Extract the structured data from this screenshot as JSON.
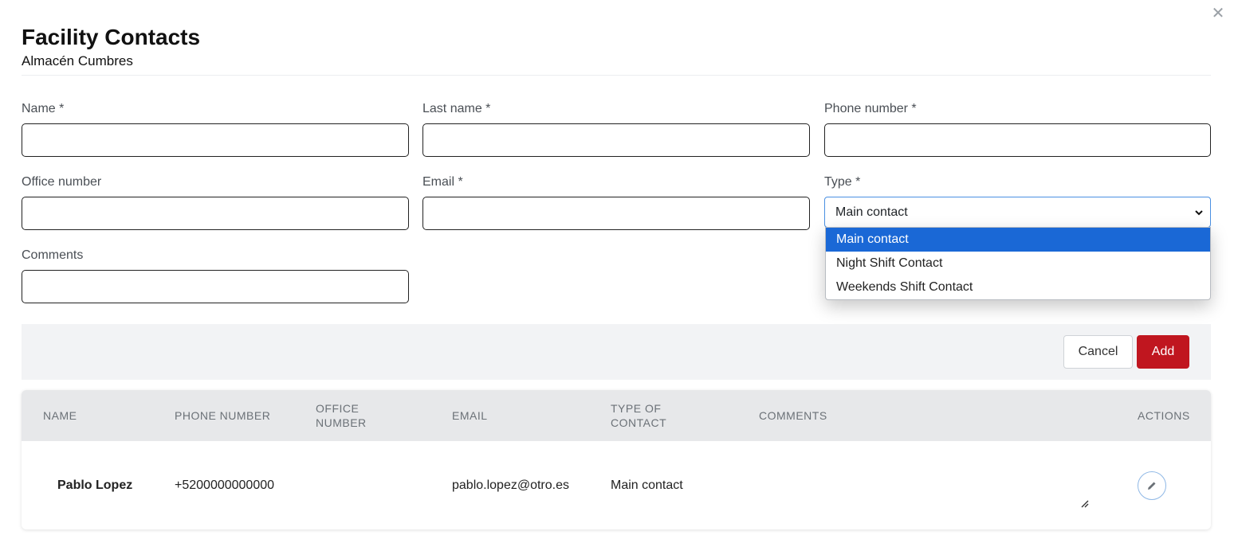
{
  "modal": {
    "title": "Facility Contacts",
    "subtitle": "Almacén Cumbres",
    "close_icon": "close-icon"
  },
  "form": {
    "name_label": "Name *",
    "last_name_label": "Last name *",
    "phone_label": "Phone number *",
    "office_label": "Office number",
    "email_label": "Email *",
    "type_label": "Type *",
    "comments_label": "Comments",
    "name_value": "",
    "last_name_value": "",
    "phone_value": "",
    "office_value": "",
    "email_value": "",
    "comments_value": "",
    "type_selected": "Main contact",
    "type_options": [
      "Main contact",
      "Night Shift Contact",
      "Weekends Shift Contact"
    ]
  },
  "actions": {
    "cancel_label": "Cancel",
    "add_label": "Add"
  },
  "table": {
    "headers": {
      "name": "NAME",
      "phone": "PHONE NUMBER",
      "office": "OFFICE NUMBER",
      "email": "EMAIL",
      "type": "TYPE OF CONTACT",
      "comments": "COMMENTS",
      "actions": "ACTIONS"
    },
    "rows": [
      {
        "name": "Pablo Lopez",
        "phone": "+5200000000000",
        "office": "",
        "email": "pablo.lopez@otro.es",
        "type": "Main contact",
        "comments": ""
      }
    ]
  },
  "colors": {
    "primary": "#c0161f",
    "selected_option": "#1a68d6",
    "focus_border": "#4a90e2"
  }
}
